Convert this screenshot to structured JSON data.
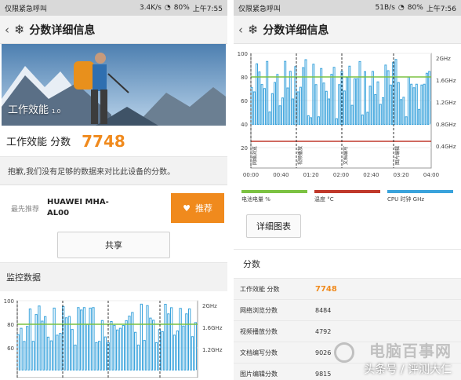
{
  "colors": {
    "accent": "#f08a1d",
    "battery": "#7cc242",
    "temperature": "#c0392b",
    "cpu": "#3aa3dc"
  },
  "left": {
    "status": {
      "carrier": "仅限紧急呼叫",
      "speed": "3.4K/s",
      "battery": "80%",
      "time": "上午7:55"
    },
    "appbar": {
      "back": "‹",
      "icon": "snowflake-icon",
      "title": "分数详细信息"
    },
    "hero": {
      "label": "工作效能",
      "version": "1.0"
    },
    "score": {
      "label": "工作效能 分数",
      "value": "7748"
    },
    "sorry": "抱歉,我们没有足够的数据来对比此设备的分数。",
    "recommend": {
      "label": "最先推荐",
      "device": "HUAWEI MHA-AL00",
      "button": "推荐"
    },
    "share": "共享",
    "monitor_title": "监控数据",
    "chart": {
      "y_ticks": [
        "100",
        "80",
        "60"
      ],
      "cpu_ticks": [
        "2GHz",
        "1.6GHz",
        "1.2GHz"
      ]
    }
  },
  "right": {
    "status": {
      "carrier": "仅限紧急呼叫",
      "speed": "51B/s",
      "battery": "80%",
      "time": "上午7:56"
    },
    "appbar": {
      "back": "‹",
      "icon": "snowflake-icon",
      "title": "分数详细信息"
    },
    "chart": {
      "y_ticks": [
        "100",
        "80",
        "60",
        "40",
        "20"
      ],
      "x_ticks": [
        "00:00",
        "00:40",
        "01:20",
        "02:00",
        "02:40",
        "03:20",
        "04:00"
      ],
      "cpu_ticks": [
        "2GHz",
        "1.6GHz",
        "1.2GHz",
        "0.8GHz",
        "0.4GHz"
      ],
      "markers": [
        "网络浏览",
        "视频播放",
        "文档编写",
        "图片编辑"
      ]
    },
    "legend": {
      "battery": "电池电量 %",
      "temperature": "温度 °C",
      "cpu": "CPU 时钟 GHz"
    },
    "detail_button": "详细图表",
    "scores_title": "分数",
    "scores": [
      {
        "name": "工作效能 分数",
        "value": "7748"
      },
      {
        "name": "网络浏览分数",
        "value": "8484"
      },
      {
        "name": "视频播放分数",
        "value": "4792"
      },
      {
        "name": "文档编写分数",
        "value": "9026"
      },
      {
        "name": "图片编辑分数",
        "value": "9815"
      }
    ],
    "watermark": {
      "brand": "电脑百事网",
      "caption": "头条号 / 评测大仁"
    }
  }
}
